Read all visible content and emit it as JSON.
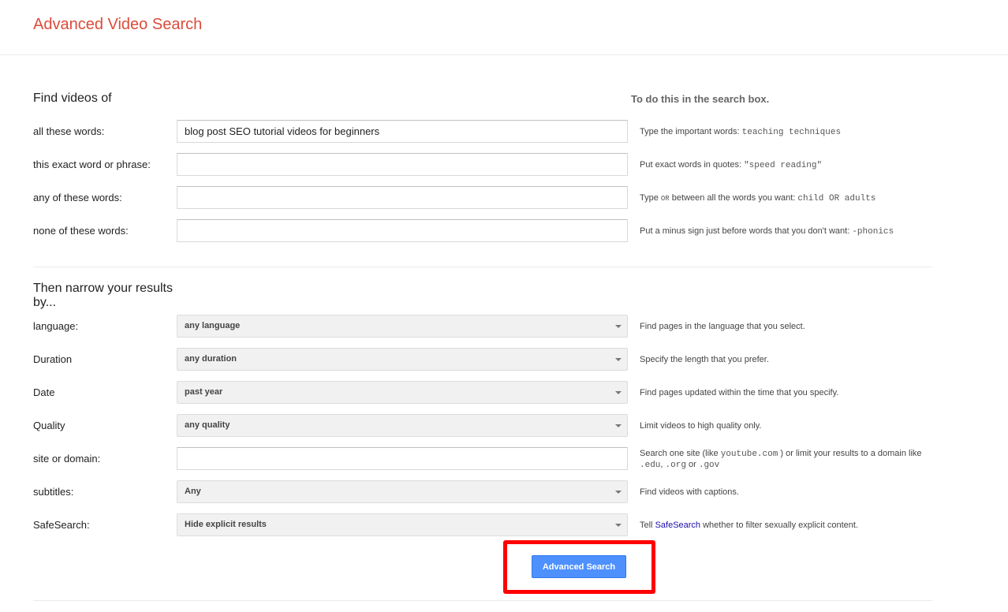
{
  "header": {
    "title": "Advanced Video Search"
  },
  "find_section": {
    "title": "Find videos of",
    "hint_title": "To do this in the search box.",
    "rows": [
      {
        "label": "all these words:",
        "value": "blog post SEO tutorial videos for beginners",
        "hint_text": "Type the important words: ",
        "hint_example": "teaching techniques"
      },
      {
        "label": "this exact word or phrase:",
        "value": "",
        "hint_text": "Put exact words in quotes: ",
        "hint_example": "\"speed reading\""
      },
      {
        "label": "any of these words:",
        "value": "",
        "hint_text_1": "Type ",
        "hint_or": "OR",
        "hint_text_2": " between all the words you want: ",
        "hint_example": "child OR adults"
      },
      {
        "label": "none of these words:",
        "value": "",
        "hint_text": "Put a minus sign just before words that you don't want: ",
        "hint_example": "-phonics"
      }
    ]
  },
  "narrow_section": {
    "title_line1": "Then narrow your results",
    "title_line2": "by...",
    "language": {
      "label": "language:",
      "value": "any language",
      "hint": "Find pages in the language that you select."
    },
    "duration": {
      "label": "Duration",
      "value": "any duration",
      "hint": "Specify the length that you prefer."
    },
    "date": {
      "label": "Date",
      "value": "past year",
      "hint": "Find pages updated within the time that you specify."
    },
    "quality": {
      "label": "Quality",
      "value": "any quality",
      "hint": "Limit videos to high quality only."
    },
    "site": {
      "label": "site or domain:",
      "value": "",
      "hint_1": "Search one site (like ",
      "hint_ex1": "youtube.com",
      "hint_2": " ) or limit your results to a domain like ",
      "hint_ex2": ".edu",
      "hint_3": ", ",
      "hint_ex3": ".org",
      "hint_4": " or ",
      "hint_ex4": ".gov"
    },
    "subtitles": {
      "label": "subtitles:",
      "value": "Any",
      "hint": "Find videos with captions."
    },
    "safesearch": {
      "label": "SafeSearch",
      "label_suffix": ":",
      "value": "Hide explicit results",
      "hint_1": "Tell ",
      "hint_link": "SafeSearch",
      "hint_2": " whether to filter sexually explicit content."
    }
  },
  "actions": {
    "submit_label": "Advanced Search"
  },
  "colors": {
    "title": "#dd4b39",
    "link": "#1a0dab",
    "button": "#4d90fe",
    "highlight": "#ff0000"
  }
}
